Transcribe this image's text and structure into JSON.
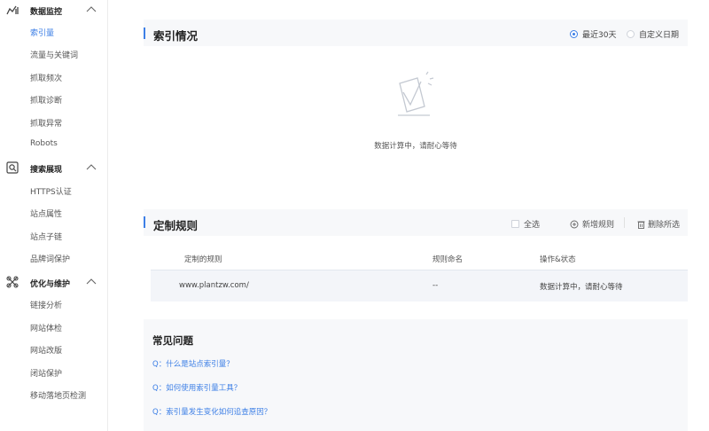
{
  "sidebar": {
    "groups": [
      {
        "title": "数据监控",
        "icon": "chart-icon",
        "items": [
          "索引量",
          "流量与关键词",
          "抓取频次",
          "抓取诊断",
          "抓取异常",
          "Robots"
        ]
      },
      {
        "title": "搜索展现",
        "icon": "search-display-icon",
        "items": [
          "HTTPS认证",
          "站点属性",
          "站点子链",
          "品牌词保护"
        ]
      },
      {
        "title": "优化与维护",
        "icon": "tools-icon",
        "items": [
          "链接分析",
          "网站体检",
          "网站改版",
          "闭站保护",
          "移动落地页检测"
        ]
      }
    ],
    "active_item": "索引量"
  },
  "index_panel": {
    "title": "索引情况",
    "radio_last30": "最近30天",
    "radio_custom": "自定义日期",
    "empty_text": "数据计算中，请耐心等待"
  },
  "rules_panel": {
    "title": "定制规则",
    "select_all": "全选",
    "add_rule": "新增规则",
    "delete_selected": "删除所选",
    "columns": [
      "定制的规则",
      "规则命名",
      "操作&状态"
    ],
    "rows": [
      {
        "rule": "www.plantzw.com/",
        "name": "--",
        "status": "数据计算中，请耐心等待"
      }
    ]
  },
  "faq": {
    "title": "常见问题",
    "questions": [
      "Q：什么是站点索引量？",
      "Q：如何使用索引量工具？",
      "Q：索引量发生变化如何追查原因？"
    ]
  },
  "colors": {
    "accent": "#3d7fe6",
    "panel_bg": "#f7f8fa"
  }
}
